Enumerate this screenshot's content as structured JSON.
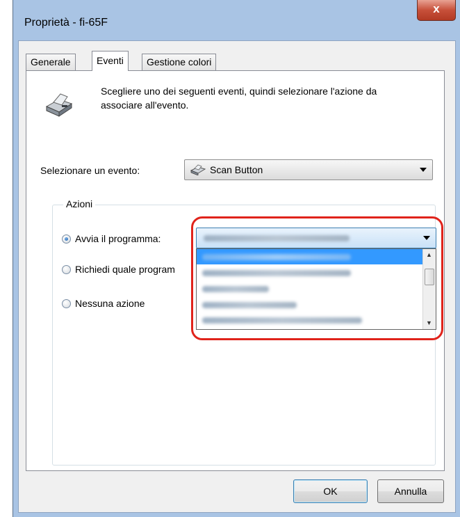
{
  "window": {
    "title": "Proprietà - fi-65F",
    "close_glyph": "x"
  },
  "tabs": [
    {
      "label": "Generale",
      "active": false
    },
    {
      "label": "Eventi",
      "active": true
    },
    {
      "label": "Gestione colori",
      "active": false
    }
  ],
  "intro": {
    "icon": "scanner-icon",
    "text": "Scegliere uno dei seguenti eventi, quindi selezionare l'azione da associare all'evento."
  },
  "event": {
    "label": "Selezionare un evento:",
    "value": "Scan Button",
    "value_icon": "scanner-small-icon"
  },
  "actions": {
    "group_title": "Azioni",
    "options": [
      {
        "label": "Avvia il programma:",
        "checked": true
      },
      {
        "label": "Richiedi quale program",
        "checked": false
      },
      {
        "label": "Nessuna azione",
        "checked": false
      }
    ]
  },
  "program_dropdown": {
    "selected_index": 0,
    "item_count": 5,
    "highlight_color": "#e0231b",
    "selection_color": "#3399ff"
  },
  "buttons": {
    "ok": "OK",
    "cancel": "Annulla"
  }
}
